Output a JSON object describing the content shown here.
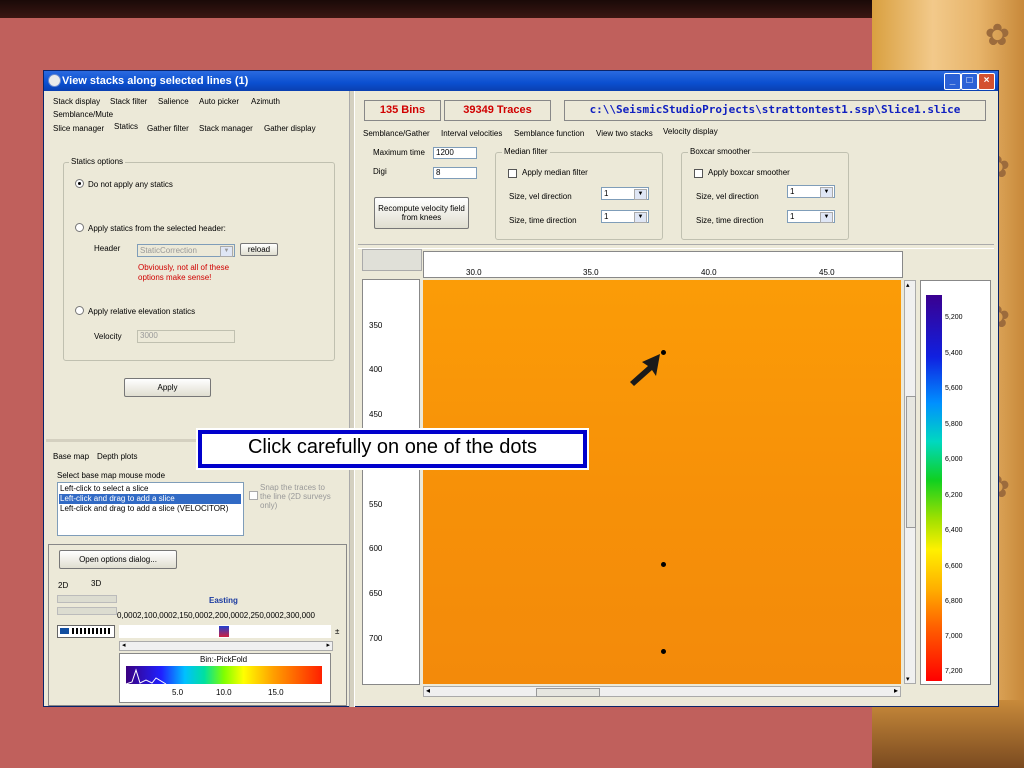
{
  "window": {
    "title": "View stacks along selected lines    (1)"
  },
  "left_tabs_row1": [
    "Stack display",
    "Stack filter",
    "Salience",
    "Auto picker",
    "Azimuth",
    "Semblance/Mute"
  ],
  "left_tabs_row2": [
    "Slice manager",
    "Statics",
    "Gather filter",
    "Stack manager",
    "Gather display"
  ],
  "statics": {
    "group_title": "Statics options",
    "opt1": "Do not apply any statics",
    "opt2": "Apply statics from the selected header:",
    "header_label": "Header",
    "header_value": "StaticCorrection",
    "reload": "reload",
    "warning1": "Obviously, not all of these",
    "warning2": "options make sense!",
    "opt3": "Apply relative elevation statics",
    "velocity_label": "Velocity",
    "velocity_value": "3000",
    "apply": "Apply"
  },
  "basemap": {
    "tabs": [
      "Base map",
      "Depth plots"
    ],
    "mode_label": "Select base map mouse mode",
    "modes": [
      "Left-click to select a slice",
      "Left-click and drag to add a slice",
      "Left-click and drag to add a slice (VELOCITOR)"
    ],
    "snap1": "Snap the traces to",
    "snap2": "the line (2D surveys",
    "snap3": "only)",
    "open_options": "Open options dialog...",
    "dim_tabs": [
      "2D",
      "3D"
    ],
    "easting_label": "Easting",
    "easting_ticks": "0,0002,100,0002,150,0002,200,0002,250,0002,300,000",
    "legend_title": "Bin:-PickFold",
    "legend_ticks": [
      "5.0",
      "10.0",
      "15.0"
    ]
  },
  "status": {
    "bins": "135 Bins",
    "traces": "39349 Traces",
    "path": "c:\\\\SeismicStudioProjects\\strattontest1.ssp\\Slice1.slice"
  },
  "right_tabs": [
    "Semblance/Gather",
    "Interval velocities",
    "Semblance function",
    "View two stacks",
    "Velocity display"
  ],
  "velocity": {
    "max_time_label": "Maximum time",
    "max_time_value": "1200",
    "digi_label": "Digi",
    "digi_value": "8",
    "recompute": "Recompute velocity field from knees",
    "median_title": "Median filter",
    "median_apply": "Apply median filter",
    "median_vel": "Size, vel direction",
    "median_time": "Size, time direction",
    "median_vel_val": "1",
    "median_time_val": "1",
    "boxcar_title": "Boxcar smoother",
    "boxcar_apply": "Apply boxcar smoother",
    "boxcar_vel": "Size, vel direction",
    "boxcar_time": "Size, time direction",
    "boxcar_vel_val": "1",
    "boxcar_time_val": "1"
  },
  "plot": {
    "x_ticks": [
      "30.0",
      "35.0",
      "40.0",
      "45.0"
    ],
    "y_ticks": [
      "350",
      "400",
      "450",
      "550",
      "600",
      "650",
      "700"
    ],
    "colorbar_ticks": [
      "5,200",
      "5,400",
      "5,600",
      "5,800",
      "6,000",
      "6,200",
      "6,400",
      "6,600",
      "6,800",
      "7,000",
      "7,200"
    ]
  },
  "callout": {
    "text": "Click carefully on one of the dots"
  },
  "colors": {
    "heat": "#f7920a",
    "title_bar": "#0a4fd0",
    "slide_bg": "#c0605c"
  }
}
